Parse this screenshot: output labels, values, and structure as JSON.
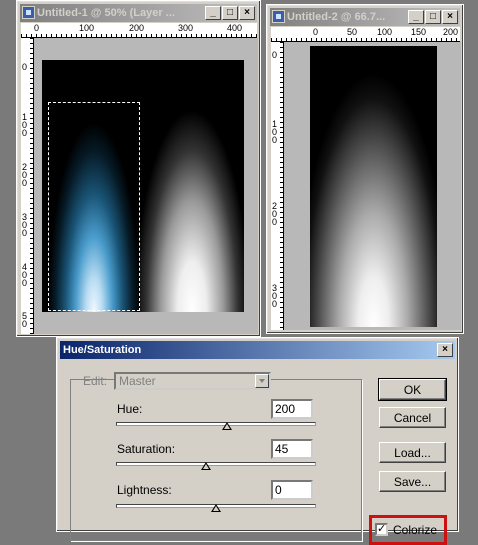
{
  "window1": {
    "title": "Untitled-1 @ 50% (Layer ...",
    "ruler_top": [
      "0",
      "100",
      "200",
      "300",
      "400"
    ],
    "ruler_left": [
      "0",
      "1 0 0",
      "2 0 0",
      "3 0 0",
      "4 0 0",
      "5 0"
    ]
  },
  "window2": {
    "title": "Untitled-2 @ 66.7...",
    "ruler_top": [
      "0",
      "50",
      "100",
      "150",
      "200"
    ],
    "ruler_left": [
      "0",
      "1 0 0",
      "2 0 0",
      "3 0 0"
    ]
  },
  "title_buttons": {
    "minimize": "_",
    "maximize": "□",
    "close": "×"
  },
  "dialog": {
    "title": "Hue/Saturation",
    "close": "×",
    "edit_label": "Edit:",
    "edit_value": "Master",
    "hue_label": "Hue:",
    "hue_value": "200",
    "hue_level": 200,
    "saturation_label": "Saturation:",
    "saturation_value": "45",
    "saturation_level": 45,
    "lightness_label": "Lightness:",
    "lightness_value": "0",
    "lightness_level": 0,
    "ok": "OK",
    "cancel": "Cancel",
    "load": "Load...",
    "save": "Save...",
    "colorize": "Colorize",
    "colorize_checked": true,
    "highlight_color": "#cc1111"
  }
}
